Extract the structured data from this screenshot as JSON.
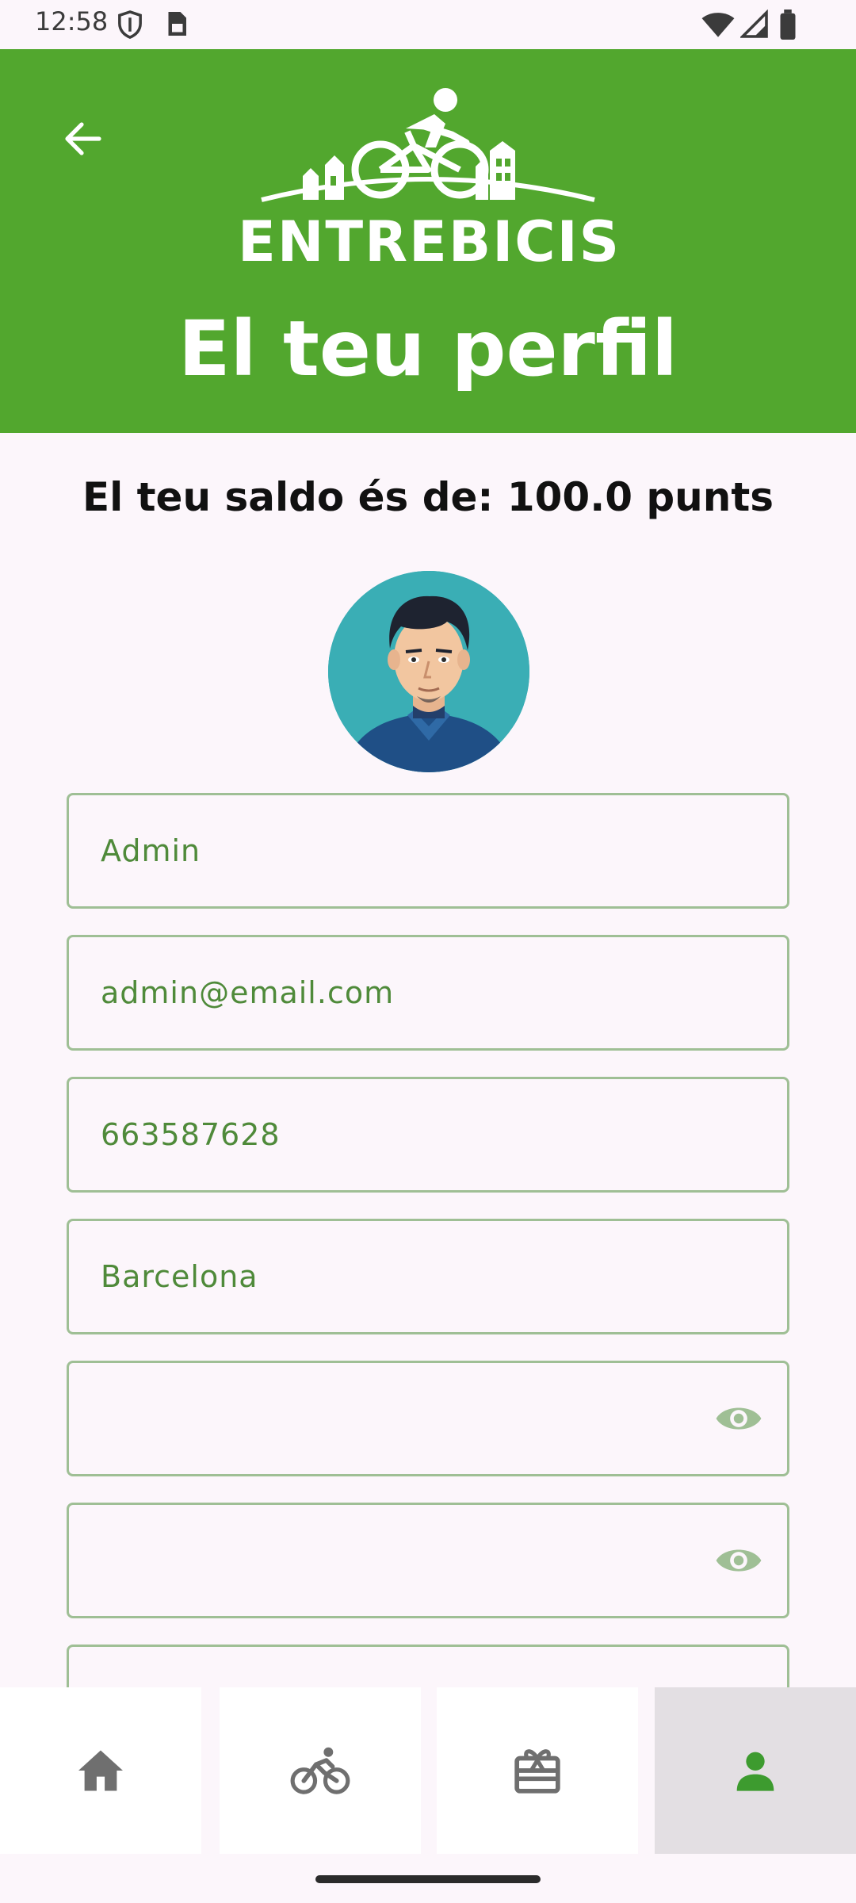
{
  "status_bar": {
    "time": "12:58",
    "icons": [
      "shield-icon",
      "sim-card-icon",
      "wifi-icon",
      "signal-icon",
      "battery-icon"
    ]
  },
  "header": {
    "back_icon": "arrow-left-icon",
    "logo_text": "ENTREBICIS",
    "title": "El teu perfil",
    "background_color": "#52a72e"
  },
  "balance": {
    "text": "El teu saldo és de: 100.0 punts"
  },
  "avatar": {
    "icon": "user-avatar-illustration"
  },
  "form": {
    "fields": [
      {
        "value": "Admin"
      },
      {
        "value": "admin@email.com"
      },
      {
        "value": "663587628"
      },
      {
        "value": "Barcelona"
      },
      {
        "value": "",
        "has_visibility_toggle": true
      },
      {
        "value": "",
        "has_visibility_toggle": true
      },
      {
        "value": ""
      }
    ],
    "accent_color": "#4f8a3a"
  },
  "bottom_nav": {
    "items": [
      {
        "icon": "home-icon",
        "active": false
      },
      {
        "icon": "bike-icon",
        "active": false
      },
      {
        "icon": "gift-card-icon",
        "active": false
      },
      {
        "icon": "person-icon",
        "active": true
      }
    ],
    "active_color": "#3d9b2f",
    "inactive_color": "#6f6f6f"
  }
}
